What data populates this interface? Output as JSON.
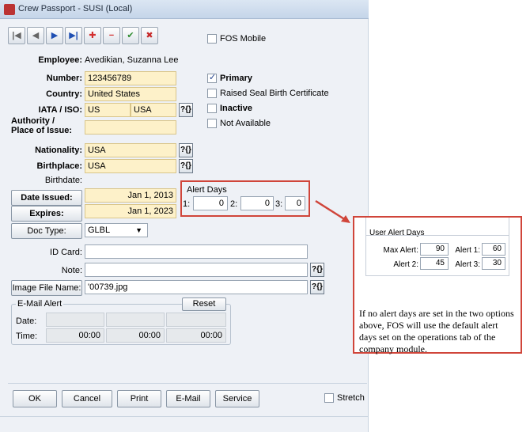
{
  "window": {
    "title": "Crew Passport - SUSI (Local)"
  },
  "toolbar": {
    "first": "|◀",
    "prev": "◀",
    "next": "▶",
    "last": "▶|",
    "add": "✚",
    "remove": "−",
    "confirm": "✔",
    "cancel": "✖",
    "colors": {
      "add": "#d32f2f",
      "remove": "#d32f2f",
      "confirm": "#2e8b2e",
      "cancel": "#c62828",
      "nav": "#1f4fb3"
    }
  },
  "fos_mobile": {
    "label": "FOS Mobile",
    "checked": false
  },
  "employee": {
    "label": "Employee:",
    "value": "Avedikian, Suzanna Lee"
  },
  "form": {
    "number": {
      "label": "Number:",
      "value": "123456789"
    },
    "country": {
      "label": "Country:",
      "value": "United States"
    },
    "iata": {
      "label": "IATA / ISO:",
      "value1": "US",
      "value2": "USA"
    },
    "authority": {
      "label_line1": "Authority /",
      "label_line2": "Place of Issue:",
      "value": ""
    },
    "nationality": {
      "label": "Nationality:",
      "value": "USA"
    },
    "birthplace": {
      "label": "Birthplace:",
      "value": "USA"
    },
    "birthdate": {
      "label": "Birthdate:",
      "value": ""
    },
    "date_issued": {
      "label": "Date Issued:",
      "value": "Jan 1, 2013"
    },
    "expires": {
      "label": "Expires:",
      "value": "Jan 1, 2023"
    },
    "doc_type": {
      "label": "Doc Type:",
      "value": "GLBL"
    },
    "id_card": {
      "label": "ID Card:",
      "value": ""
    },
    "note": {
      "label": "Note:",
      "value": ""
    },
    "image_file": {
      "label": "Image File Name:",
      "value": "'00739.jpg"
    }
  },
  "help_glyph": "?{}",
  "checkboxes": [
    {
      "label": "Primary",
      "checked": true,
      "bold": true
    },
    {
      "label": "Raised Seal Birth Certificate",
      "checked": false,
      "bold": false
    },
    {
      "label": "Inactive",
      "checked": false,
      "bold": true
    },
    {
      "label": "Not Available",
      "checked": false,
      "bold": false
    }
  ],
  "alert_days": {
    "title": "Alert Days",
    "l1": "1:",
    "v1": "0",
    "l2": "2:",
    "v2": "0",
    "l3": "3:",
    "v3": "0"
  },
  "email_alert": {
    "title": "E-Mail Alert",
    "reset": "Reset",
    "date_label": "Date:",
    "time_label": "Time:",
    "times": [
      "00:00",
      "00:00",
      "00:00"
    ]
  },
  "bottom_buttons": [
    "OK",
    "Cancel",
    "Print",
    "E-Mail",
    "Service"
  ],
  "stretch": {
    "label": "Stretch",
    "checked": false
  },
  "callout": {
    "panel_title": "User Alert Days",
    "max_alert_label": "Max Alert:",
    "max_alert": "90",
    "alert1_label": "Alert 1:",
    "alert1": "60",
    "alert2_label": "Alert 2:",
    "alert2": "45",
    "alert3_label": "Alert 3:",
    "alert3": "30",
    "text": "If no alert days are set in the two options above, FOS will use the default alert days set on the operations tab of the company module."
  },
  "colors": {
    "highlight": "#d0453a",
    "required_field": "#fdf1c9"
  }
}
